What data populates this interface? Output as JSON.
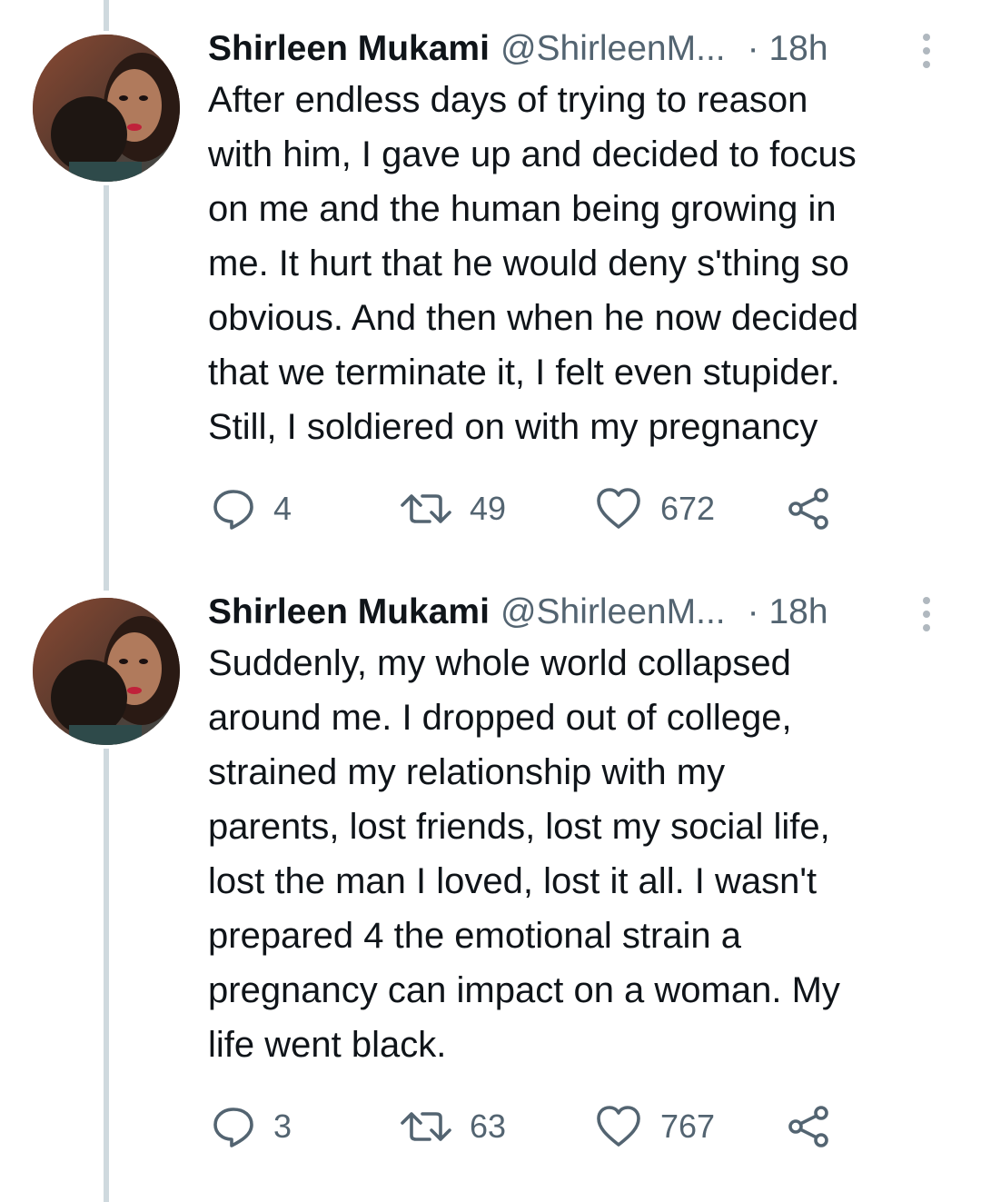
{
  "tweets": [
    {
      "author": {
        "name": "Shirleen Mukami",
        "handle": "@ShirleenM...",
        "time": "· 18h"
      },
      "text": "After endless days of trying to reason\nwith him, I gave up and decided to focus\non me and the human being growing in\nme. It hurt that he would deny s'thing so\nobvious. And then when he now decided\nthat we terminate it, I felt even stupider.\nStill, I soldiered on with my pregnancy",
      "actions": {
        "replies": "4",
        "retweets": "49",
        "likes": "672"
      }
    },
    {
      "author": {
        "name": "Shirleen Mukami",
        "handle": "@ShirleenM...",
        "time": "· 18h"
      },
      "text": "Suddenly, my whole world collapsed\naround me. I dropped out of college,\nstrained my relationship with my\nparents, lost friends, lost my social life,\nlost the man I loved, lost it all. I wasn't\nprepared 4 the emotional strain a\npregnancy can impact on a woman. My\nlife went black.",
      "actions": {
        "replies": "3",
        "retweets": "63",
        "likes": "767"
      }
    }
  ],
  "icons": {
    "more": "more-vertical-icon",
    "reply": "reply-bubble-icon",
    "retweet": "retweet-icon",
    "like": "heart-icon",
    "share": "share-icon"
  },
  "colors": {
    "text_primary": "#0f1419",
    "text_secondary": "#536471",
    "thread_line": "#cfd9de"
  }
}
